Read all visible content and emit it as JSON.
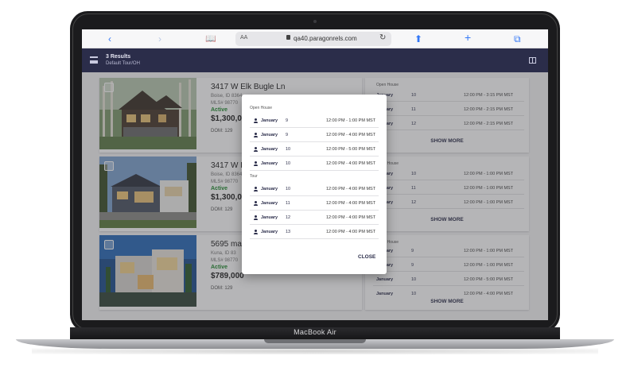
{
  "device": {
    "label": "MacBook Air"
  },
  "browser": {
    "text_size": "AA",
    "url": "qa40.paragonrels.com",
    "icons": [
      "back-icon",
      "forward-icon",
      "bookmarks-icon",
      "lock-icon",
      "reload-icon",
      "share-icon",
      "new-tab-icon",
      "tabs-icon"
    ]
  },
  "header": {
    "title": "3 Results",
    "subtitle": "Default Tour/OH"
  },
  "listings": [
    {
      "address": "3417 W Elk Bugle Ln",
      "city": "Boise, ID 8364",
      "mls": "MLS# 98770",
      "status": "Active",
      "price": "$1,300,00",
      "dom": "DOM: 129"
    },
    {
      "address": "3417 W El",
      "city": "Boise, ID 8364",
      "mls": "MLS# 98770",
      "status": "Active",
      "price": "$1,300,00",
      "dom": "DOM: 129"
    },
    {
      "address": "5695 mai",
      "city": "Kuna, ID 83",
      "mls": "MLS# 98770",
      "status": "Active",
      "price": "$789,000",
      "dom": "DOM: 129"
    }
  ],
  "schedules": [
    {
      "title": "Open House",
      "rows": [
        {
          "month": "January",
          "day": "10",
          "time": "12:00 PM - 3:15 PM MST"
        },
        {
          "month": "January",
          "day": "11",
          "time": "12:00 PM - 2:15 PM MST"
        },
        {
          "month": "January",
          "day": "12",
          "time": "12:00 PM - 2:15 PM MST"
        }
      ],
      "show_more": "SHOW MORE"
    },
    {
      "title": "Open House",
      "rows": [
        {
          "month": "January",
          "day": "10",
          "time": "12:00 PM - 1:00 PM MST"
        },
        {
          "month": "January",
          "day": "11",
          "time": "12:00 PM - 1:00 PM MST"
        },
        {
          "month": "January",
          "day": "12",
          "time": "12:00 PM - 1:00 PM MST"
        }
      ],
      "show_more": "SHOW MORE"
    },
    {
      "title": "Open House",
      "rows": [
        {
          "month": "January",
          "day": "9",
          "time": "12:00 PM - 1:00 PM MST"
        },
        {
          "month": "January",
          "day": "9",
          "time": "12:00 PM - 1:00 PM MST"
        },
        {
          "month": "January",
          "day": "10",
          "time": "12:00 PM - 5:00 PM MST"
        },
        {
          "month": "January",
          "day": "10",
          "time": "12:00 PM - 4:00 PM MST"
        }
      ],
      "show_more": "SHOW MORE"
    }
  ],
  "modal": {
    "open_house_label": "Open House",
    "open_house": [
      {
        "month": "January",
        "day": "9",
        "time": "12:00 PM - 1:00 PM MST"
      },
      {
        "month": "January",
        "day": "9",
        "time": "12:00 PM - 4:00 PM MST"
      },
      {
        "month": "January",
        "day": "10",
        "time": "12:00 PM - 5:00 PM MST"
      },
      {
        "month": "January",
        "day": "10",
        "time": "12:00 PM - 4:00 PM MST"
      }
    ],
    "tour_label": "Tour",
    "tour": [
      {
        "month": "January",
        "day": "10",
        "time": "12:00 PM - 4:00 PM MST"
      },
      {
        "month": "January",
        "day": "11",
        "time": "12:00 PM - 4:00 PM MST"
      },
      {
        "month": "January",
        "day": "12",
        "time": "12:00 PM - 4:00 PM MST"
      },
      {
        "month": "January",
        "day": "13",
        "time": "12:00 PM - 4:00 PM MST"
      }
    ],
    "close_label": "CLOSE"
  }
}
